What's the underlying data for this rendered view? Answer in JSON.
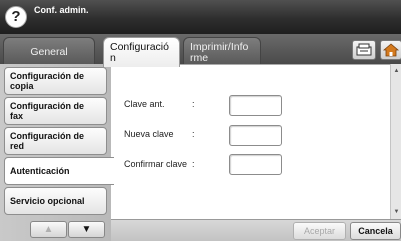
{
  "header": {
    "title": "Conf. admin.",
    "help_label": "?"
  },
  "tabs": [
    {
      "label": "General",
      "active": false
    },
    {
      "label": "Configuració\nn",
      "active": true
    },
    {
      "label": "Imprimir/Info\nrme",
      "active": false
    }
  ],
  "toolbar": {
    "machine_icon": "machine-status-icon",
    "home_icon": "home-icon"
  },
  "sidebar": {
    "items": [
      {
        "label": "Configuración de\ncopia"
      },
      {
        "label": "Configuración de\nfax"
      },
      {
        "label": "Configuración de\nred"
      },
      {
        "label": "Autenticación",
        "selected": true
      },
      {
        "label": "Servicio opcional"
      }
    ],
    "up_symbol": "▲",
    "down_symbol": "▼"
  },
  "form": {
    "fields": [
      {
        "label": "Clave ant.",
        "colon": ":",
        "value": ""
      },
      {
        "label": "Nueva clave",
        "colon": ":",
        "value": ""
      },
      {
        "label": "Confirmar clave",
        "colon": ":",
        "value": ""
      }
    ]
  },
  "scroll": {
    "up_symbol": "▲",
    "down_symbol": "▼"
  },
  "buttons": {
    "accept_label": "Aceptar",
    "cancel_label": "Cancela"
  },
  "colors": {
    "header_bg": "#2e2e2e",
    "sidebar_bg": "#c2c2c2",
    "disabled_text": "#a8a8a8"
  }
}
